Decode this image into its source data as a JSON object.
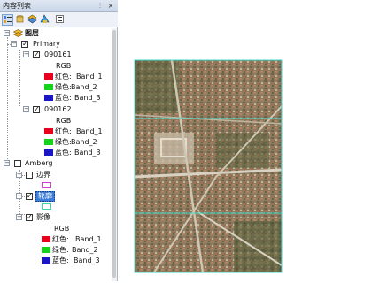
{
  "panel": {
    "title": "内容列表",
    "pin_glyph": "⫶",
    "close_glyph": "×"
  },
  "toolbar": {
    "buttons": [
      "list-by-drawing-order",
      "list-by-source",
      "list-by-visibility",
      "list-by-selection",
      "options"
    ]
  },
  "tree": {
    "root_label": "图层",
    "groups": [
      {
        "label": "Primary",
        "layers": [
          {
            "label": "090161",
            "rgb": "RGB",
            "red": "红色:",
            "red_band": "Band_1",
            "green": "绿色:",
            "green_band": "Band_2",
            "blue": "蓝色:",
            "blue_band": "Band_3"
          },
          {
            "label": "090162",
            "rgb": "RGB",
            "red": "红色:",
            "red_band": "Band_1",
            "green": "绿色:",
            "green_band": "Band_2",
            "blue": "蓝色:",
            "blue_band": "Band_3"
          }
        ]
      },
      {
        "label": "Amberg",
        "layers": [
          {
            "label": "边界"
          },
          {
            "label": "轮廓"
          },
          {
            "label": "影像",
            "rgb": "RGB",
            "red": "红色:",
            "red_band": "Band_1",
            "green": "绿色:",
            "green_band": "Band_2",
            "blue": "蓝色:",
            "blue_band": "Band_3"
          }
        ]
      }
    ]
  },
  "colors": {
    "red": "#e8001c",
    "green": "#16d21c",
    "blue": "#1a16c8",
    "boundary_outline": "#d33fd0",
    "outline_outline": "#3ad9a5",
    "tile_border": "#3ad9c9",
    "selection": "#3b7dd8"
  },
  "map": {
    "content": "aerial-imagery-of-town",
    "tiles": 3
  }
}
